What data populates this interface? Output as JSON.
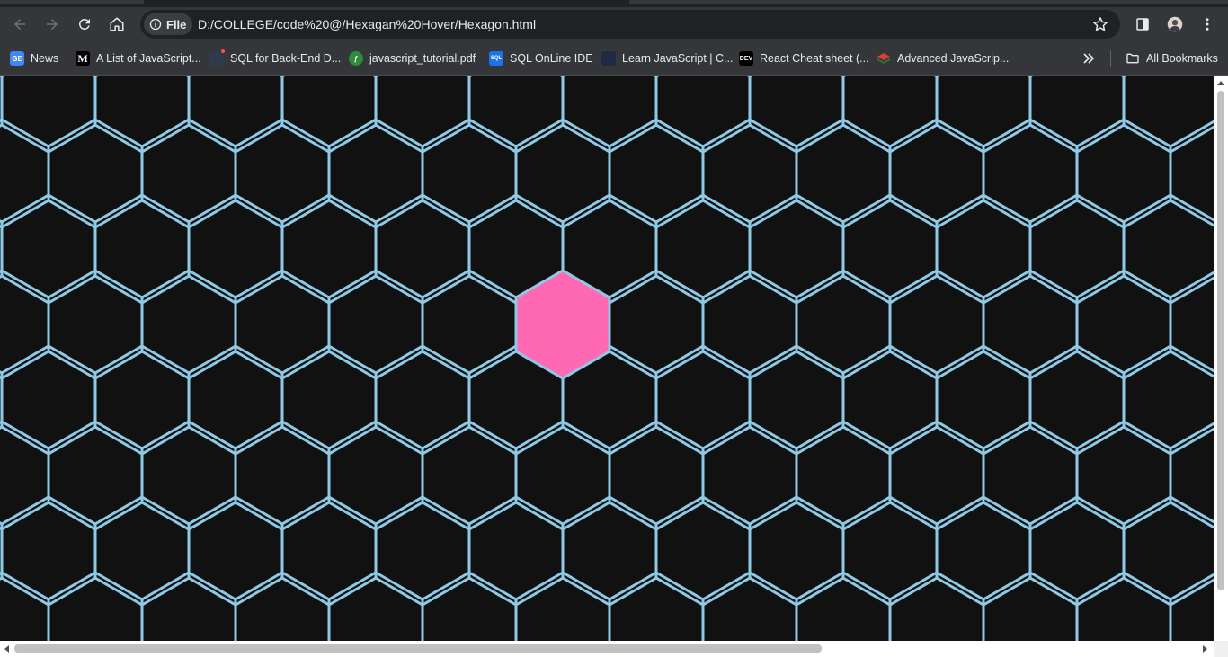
{
  "toolbar": {
    "site_chip_label": "File",
    "url": "D:/COLLEGE/code%20@/Hexagan%20Hover/Hexagon.html"
  },
  "bookmarks": {
    "items": [
      {
        "label": "News",
        "icon": "ge-news-icon",
        "color": "#4285f4"
      },
      {
        "label": "A List of JavaScript...",
        "icon": "medium-icon",
        "color": "#000000"
      },
      {
        "label": "SQL for Back-End D...",
        "icon": "site-icon",
        "color": "#2f3a4a"
      },
      {
        "label": "javascript_tutorial.pdf",
        "icon": "pdf-icon",
        "color": "#2e8b3a"
      },
      {
        "label": "SQL OnLine IDE",
        "icon": "sql-icon",
        "color": "#1a73e8"
      },
      {
        "label": "Learn JavaScript | C...",
        "icon": "codecademy-icon",
        "color": "#1f2a44"
      },
      {
        "label": "React Cheat sheet (...",
        "icon": "dev-icon",
        "color": "#000000"
      },
      {
        "label": "Advanced JavaScrip...",
        "icon": "layers-icon",
        "color": "#e53935"
      }
    ],
    "all_bookmarks_label": "All Bookmarks"
  },
  "page": {
    "background": "#111112",
    "grid_stroke": "#8ecae6",
    "hover_fill": "#ff69b4",
    "hovered_hexagon": {
      "column": 6,
      "row": 3
    }
  }
}
